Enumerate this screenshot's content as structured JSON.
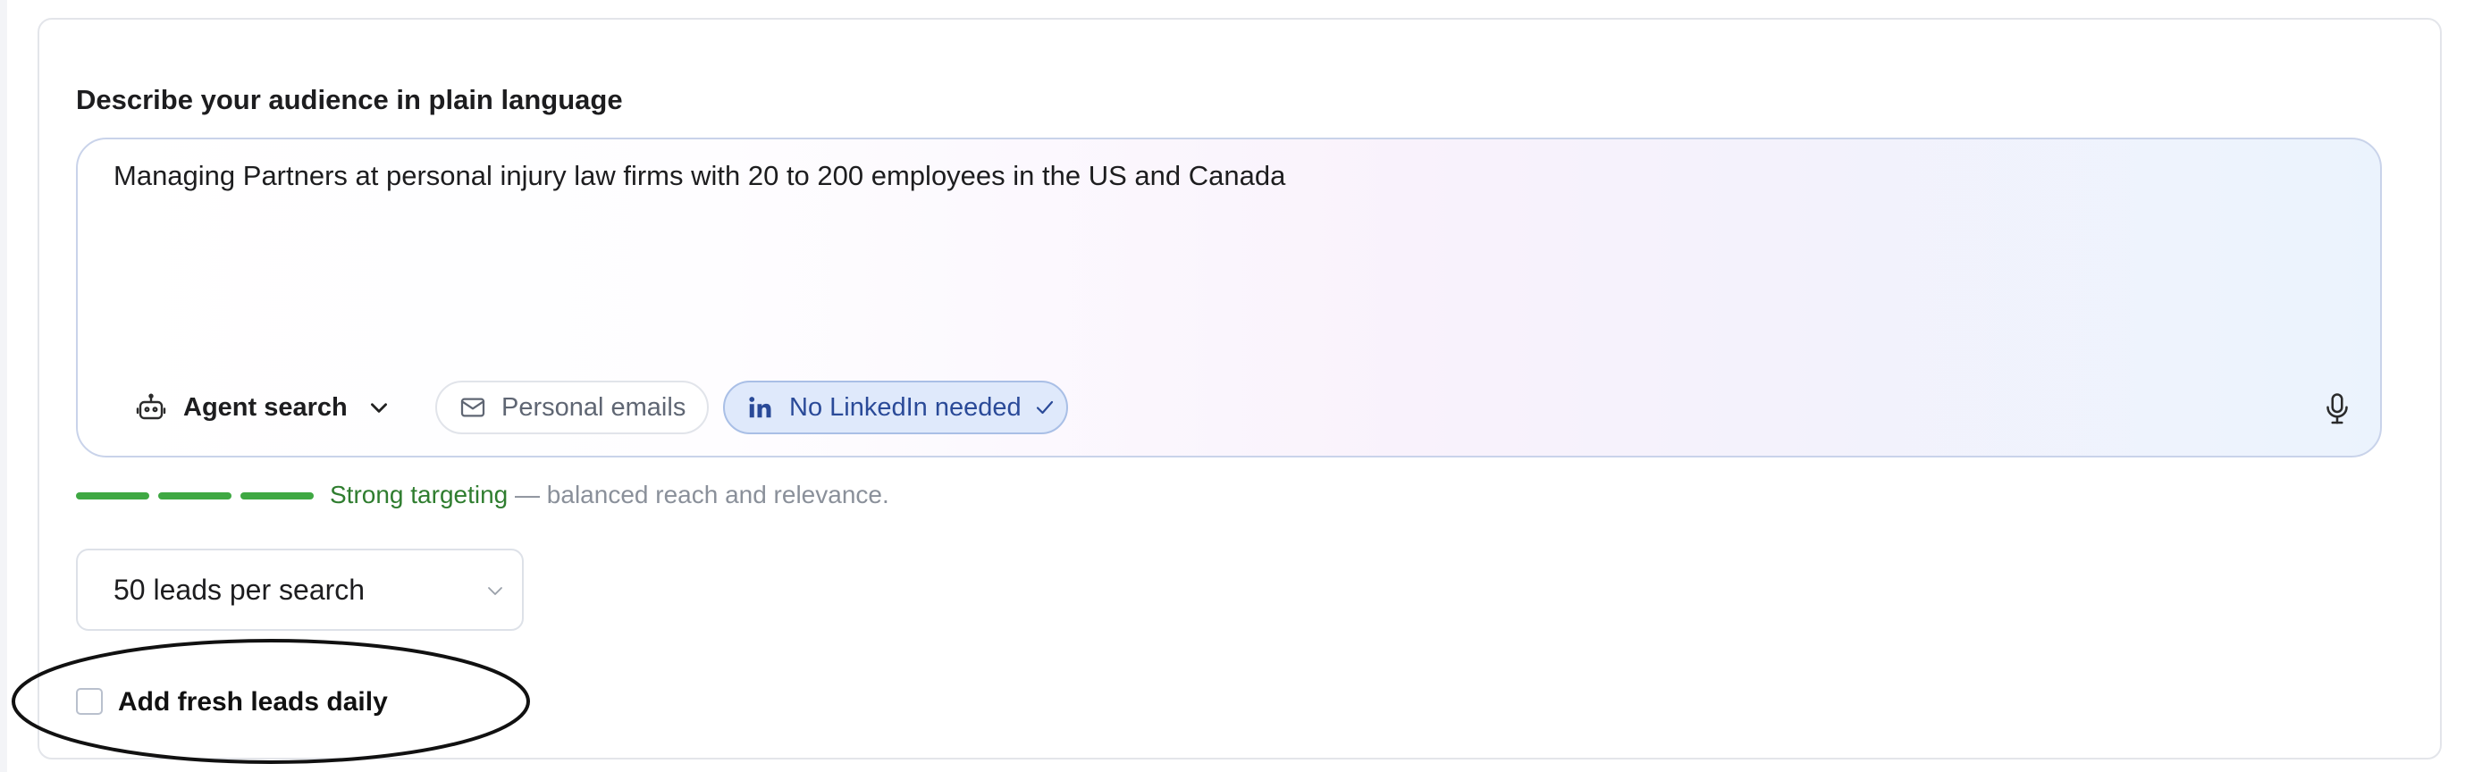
{
  "section": {
    "label": "Describe your audience in plain language"
  },
  "prompt": {
    "value": "Managing Partners at personal injury law firms with 20 to 200 employees in the US and Canada"
  },
  "toolbar": {
    "agent_search": {
      "label": "Agent search",
      "icon": "robot-icon"
    },
    "personal_emails": {
      "label": "Personal emails",
      "icon": "mail-icon"
    },
    "no_linkedin": {
      "label": "No LinkedIn needed",
      "icon": "linkedin-icon",
      "selected": true
    },
    "mic_icon": "microphone-icon"
  },
  "targeting": {
    "level_segments": 3,
    "strong_label": "Strong targeting",
    "description": " — balanced reach and relevance.",
    "color": "#3fa843"
  },
  "leads_select": {
    "value": "50 leads per search"
  },
  "fresh_leads": {
    "label": "Add fresh leads daily",
    "checked": false
  },
  "colors": {
    "accent_blue": "#2a4a98",
    "success_green": "#2f7d2f"
  }
}
